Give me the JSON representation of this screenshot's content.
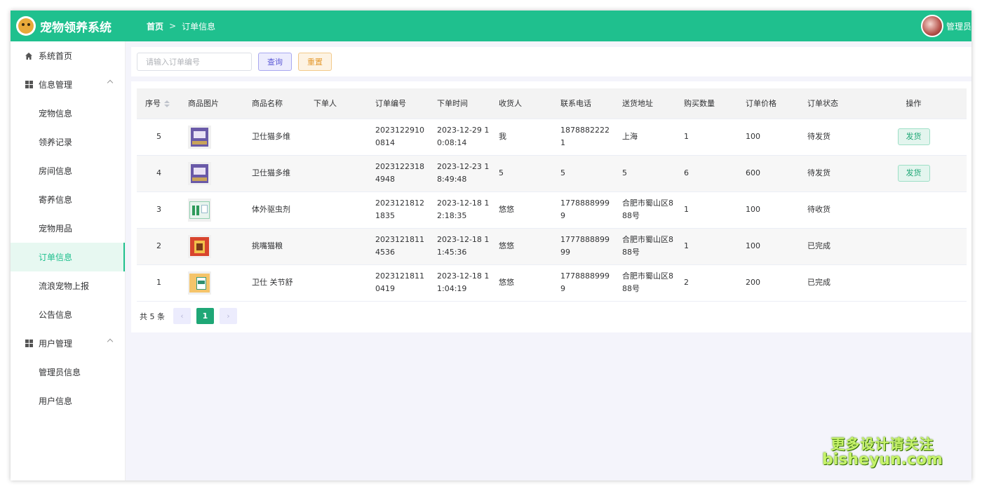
{
  "app": {
    "title": "宠物领养系统",
    "user_name": "管理员"
  },
  "breadcrumb": {
    "home": "首页",
    "separator": ">",
    "current": "订单信息"
  },
  "sidebar": {
    "items": [
      {
        "label": "系统首页",
        "type": "top",
        "icon": "home-icon"
      },
      {
        "label": "信息管理",
        "type": "group",
        "icon": "grid-icon"
      },
      {
        "label": "宠物信息",
        "type": "sub"
      },
      {
        "label": "领养记录",
        "type": "sub"
      },
      {
        "label": "房间信息",
        "type": "sub"
      },
      {
        "label": "寄养信息",
        "type": "sub"
      },
      {
        "label": "宠物用品",
        "type": "sub"
      },
      {
        "label": "订单信息",
        "type": "sub",
        "active": true
      },
      {
        "label": "流浪宠物上报",
        "type": "sub"
      },
      {
        "label": "公告信息",
        "type": "sub"
      },
      {
        "label": "用户管理",
        "type": "group",
        "icon": "grid-icon"
      },
      {
        "label": "管理员信息",
        "type": "sub"
      },
      {
        "label": "用户信息",
        "type": "sub"
      }
    ]
  },
  "search": {
    "placeholder": "请输入订单编号",
    "value": "",
    "query_label": "查询",
    "reset_label": "重置"
  },
  "table": {
    "columns": [
      "序号",
      "商品图片",
      "商品名称",
      "下单人",
      "订单编号",
      "下单时间",
      "收货人",
      "联系电话",
      "送货地址",
      "购买数量",
      "订单价格",
      "订单状态",
      "操作"
    ],
    "rows": [
      {
        "id": "5",
        "image": "product-cat-vitamin",
        "name": "卫仕猫多维",
        "buyer": "",
        "order_no": "20231229100814",
        "time": "2023-12-29 10:08:14",
        "receiver": "我",
        "phone": "18788822221",
        "address": "上海",
        "qty": "1",
        "price": "100",
        "status": "待发货",
        "action": "发货"
      },
      {
        "id": "4",
        "image": "product-cat-vitamin",
        "name": "卫仕猫多维",
        "buyer": "",
        "order_no": "20231223184948",
        "time": "2023-12-23 18:49:48",
        "receiver": "5",
        "phone": "5",
        "address": "5",
        "qty": "6",
        "price": "600",
        "status": "待发货",
        "action": "发货"
      },
      {
        "id": "3",
        "image": "product-deworm",
        "name": "体外驱虫剂",
        "buyer": "",
        "order_no": "20231218121835",
        "time": "2023-12-18 12:18:35",
        "receiver": "悠悠",
        "phone": "17788889999",
        "address": "合肥市蜀山区888号",
        "qty": "1",
        "price": "100",
        "status": "待收货",
        "action": ""
      },
      {
        "id": "2",
        "image": "product-cat-food",
        "name": "挑嘴猫粮",
        "buyer": "",
        "order_no": "20231218114536",
        "time": "2023-12-18 11:45:36",
        "receiver": "悠悠",
        "phone": "177788889999",
        "address": "合肥市蜀山区888号",
        "qty": "1",
        "price": "100",
        "status": "已完成",
        "action": ""
      },
      {
        "id": "1",
        "image": "product-joint-care",
        "name": "卫仕 关节舒",
        "buyer": "",
        "order_no": "20231218110419",
        "time": "2023-12-18 11:04:19",
        "receiver": "悠悠",
        "phone": "17788889999",
        "address": "合肥市蜀山区888号",
        "qty": "2",
        "price": "200",
        "status": "已完成",
        "action": ""
      }
    ]
  },
  "pagination": {
    "total_text": "共 5 条",
    "current_page": "1",
    "prev": "‹",
    "next": "›"
  },
  "watermark": {
    "line1": "更多设计请关注",
    "line2": "bisheyun.com"
  },
  "colors": {
    "primary": "#1fc08e",
    "query": "#5c5ad6",
    "reset": "#e49a2f"
  }
}
